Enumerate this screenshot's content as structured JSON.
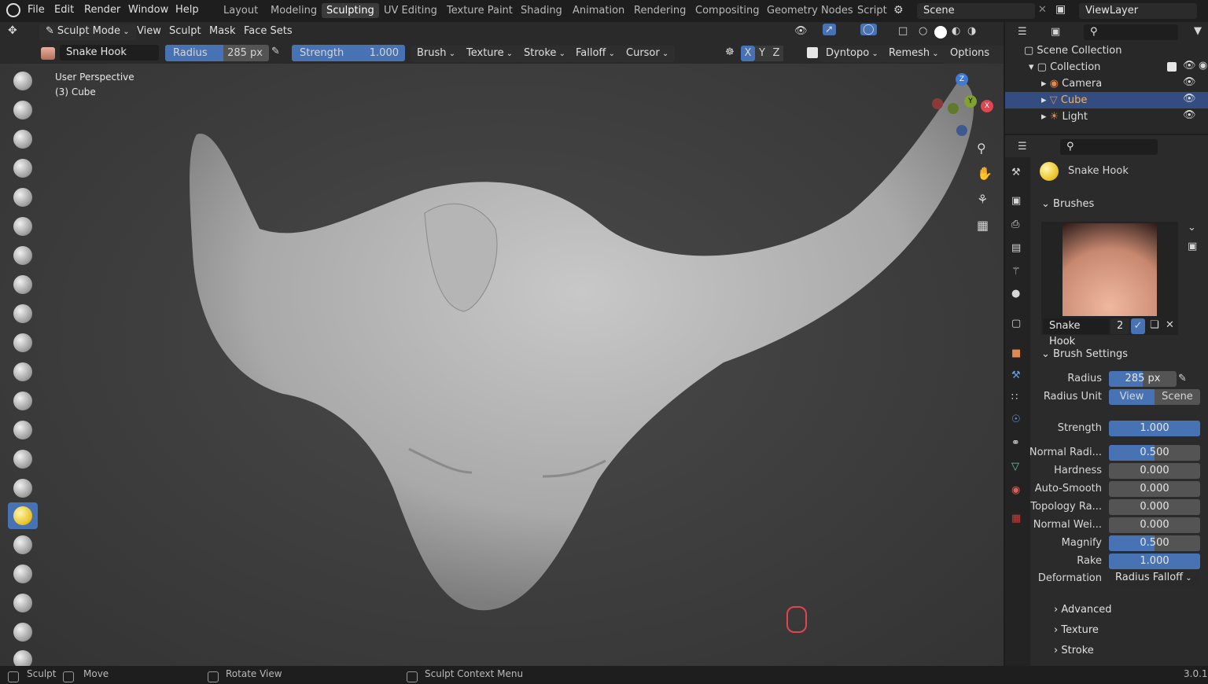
{
  "topbar": {
    "menus": [
      "File",
      "Edit",
      "Render",
      "Window",
      "Help"
    ],
    "workspaces": [
      "Layout",
      "Modeling",
      "Sculpting",
      "UV Editing",
      "Texture Paint",
      "Shading",
      "Animation",
      "Rendering",
      "Compositing",
      "Geometry Nodes",
      "Script"
    ],
    "active_workspace": "Sculpting",
    "scene": "Scene",
    "view_layer": "ViewLayer"
  },
  "header": {
    "mode": "Sculpt Mode",
    "menus": [
      "View",
      "Sculpt",
      "Mask",
      "Face Sets"
    ]
  },
  "toolheader": {
    "brush_name": "Snake Hook",
    "radius_label": "Radius",
    "radius_value": "285 px",
    "strength_label": "Strength",
    "strength_value": "1.000",
    "strength_fill": 1.0,
    "dropdowns": [
      "Brush",
      "Texture",
      "Stroke",
      "Falloff",
      "Cursor"
    ],
    "axes": [
      "X",
      "Y",
      "Z"
    ],
    "dyntopo": "Dyntopo",
    "remesh": "Remesh",
    "options": "Options"
  },
  "viewport": {
    "perspective": "User Perspective",
    "object": "(3) Cube",
    "gizmo": {
      "z": "Z",
      "y": "Y",
      "x": "X"
    }
  },
  "outliner": {
    "root": "Scene Collection",
    "collection": "Collection",
    "items": [
      "Camera",
      "Cube",
      "Light"
    ],
    "selected": "Cube"
  },
  "properties": {
    "active_brush": "Snake Hook",
    "brushes_header": "Brushes",
    "brush_preview_name": "Snake Hook",
    "brush_users": "2",
    "settings_header": "Brush Settings",
    "radius_label": "Radius",
    "radius_value": "285 px",
    "radius_unit_label": "Radius Unit",
    "radius_unit_options": [
      "View",
      "Scene"
    ],
    "radius_unit_selected": "View",
    "rows": [
      {
        "label": "Strength",
        "value": "1.000",
        "fill": 1.0
      },
      {
        "label": "Normal Radi...",
        "value": "0.500",
        "fill": 0.5
      },
      {
        "label": "Hardness",
        "value": "0.000",
        "fill": 0.0
      },
      {
        "label": "Auto-Smooth",
        "value": "0.000",
        "fill": 0.0
      },
      {
        "label": "Topology Ra...",
        "value": "0.000",
        "fill": 0.0
      },
      {
        "label": "Normal Wei...",
        "value": "0.000",
        "fill": 0.0
      },
      {
        "label": "Magnify",
        "value": "0.500",
        "fill": 0.5
      },
      {
        "label": "Rake",
        "value": "1.000",
        "fill": 1.0
      }
    ],
    "deformation_label": "Deformation",
    "deformation_value": "Radius Falloff",
    "subpanels": [
      "Advanced",
      "Texture",
      "Stroke"
    ]
  },
  "status": {
    "items": [
      "Sculpt",
      "Move",
      "Rotate View",
      "Sculpt Context Menu"
    ],
    "version": "3.0.1"
  },
  "colors": {
    "accent": "#4772b3",
    "bg": "#1d1d1d",
    "panel": "#2b2b2b",
    "viewport": "#404040"
  }
}
